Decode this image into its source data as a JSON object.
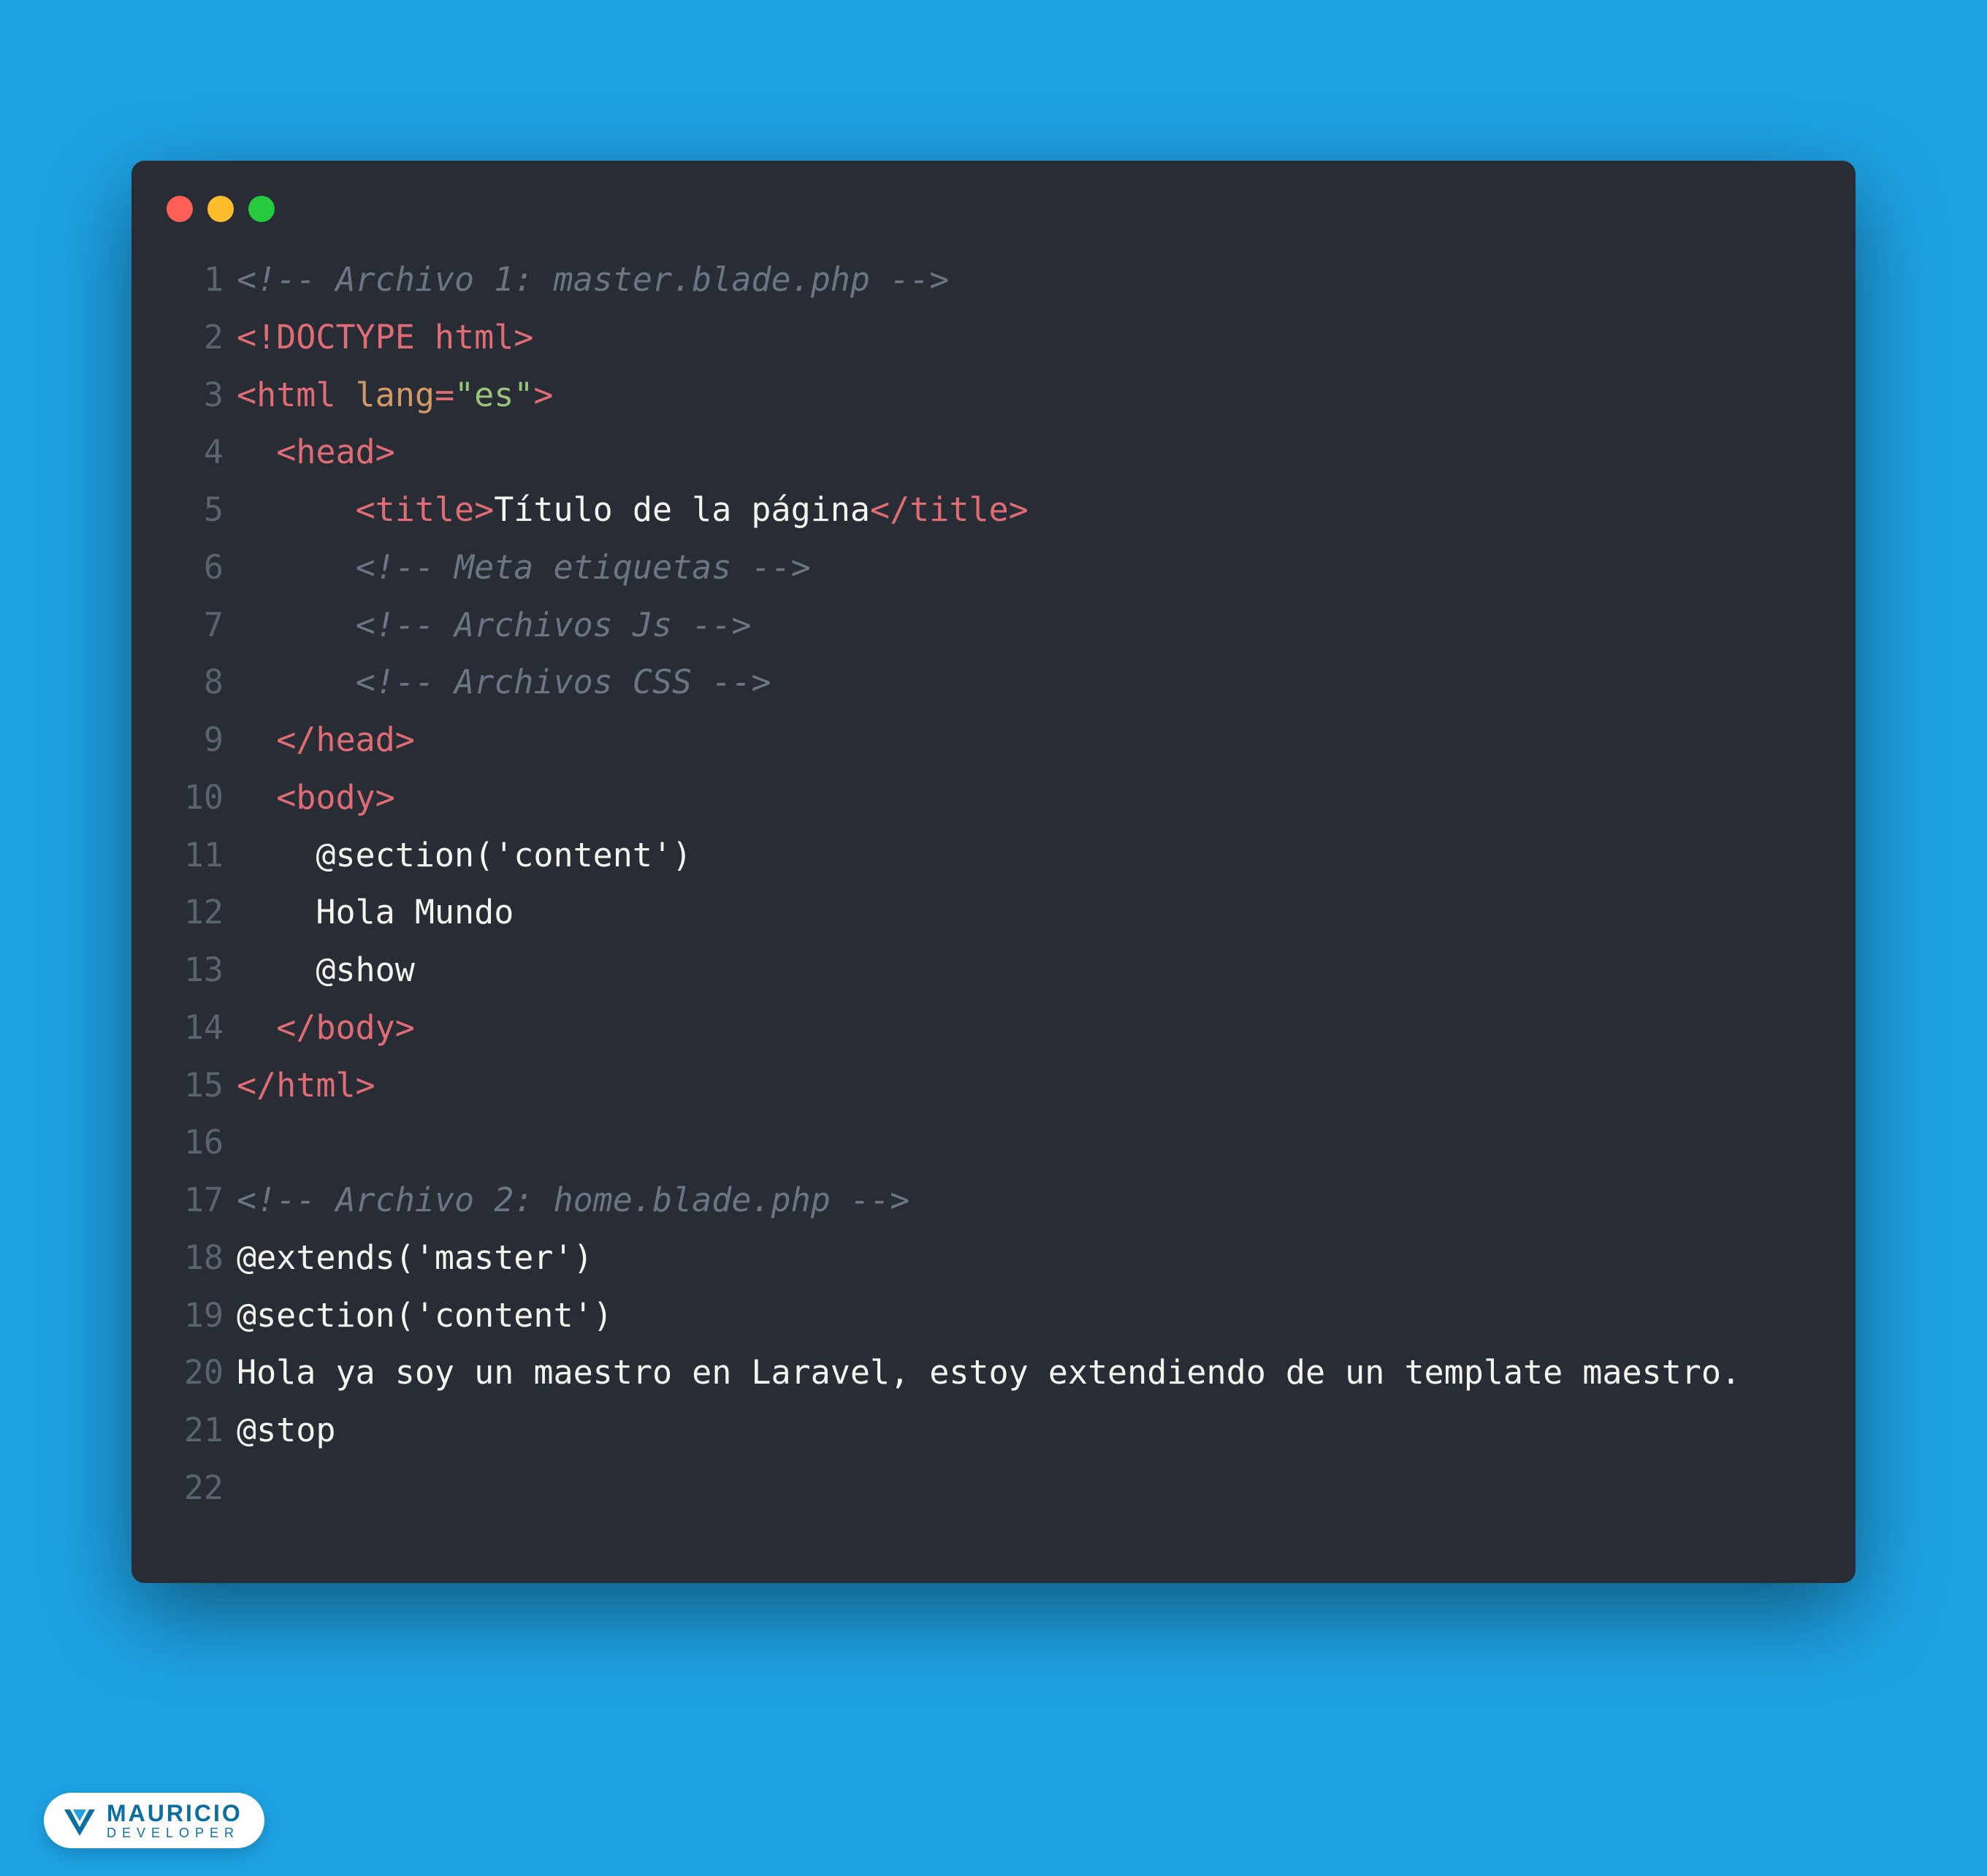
{
  "window": {
    "traffic_lights": [
      "close",
      "minimize",
      "zoom"
    ]
  },
  "code": {
    "lines": [
      {
        "n": 1,
        "segments": [
          {
            "c": "comment",
            "t": "<!--"
          },
          {
            "c": "comment sp",
            "t": " "
          },
          {
            "c": "comment",
            "t": "Archivo"
          },
          {
            "c": "comment sp",
            "t": " "
          },
          {
            "c": "comment",
            "t": "1:"
          },
          {
            "c": "comment sp",
            "t": " "
          },
          {
            "c": "comment",
            "t": "master.blade.php"
          },
          {
            "c": "comment sp",
            "t": " "
          },
          {
            "c": "comment",
            "t": "-->"
          }
        ]
      },
      {
        "n": 2,
        "segments": [
          {
            "c": "tag",
            "t": "<!DOCTYPE html>"
          }
        ]
      },
      {
        "n": 3,
        "segments": [
          {
            "c": "tag",
            "t": "<html "
          },
          {
            "c": "attr",
            "t": "lang"
          },
          {
            "c": "tag",
            "t": "="
          },
          {
            "c": "str",
            "t": "\"es\""
          },
          {
            "c": "tag",
            "t": ">"
          }
        ]
      },
      {
        "n": 4,
        "indent": "  ",
        "segments": [
          {
            "c": "tag",
            "t": "<head>"
          }
        ]
      },
      {
        "n": 5,
        "indent": "      ",
        "segments": [
          {
            "c": "tag",
            "t": "<title>"
          },
          {
            "c": "plain",
            "t": "Título de la página"
          },
          {
            "c": "tag",
            "t": "</title>"
          }
        ]
      },
      {
        "n": 6,
        "indent": "      ",
        "segments": [
          {
            "c": "comment",
            "t": "<!--"
          },
          {
            "c": "comment sp",
            "t": " "
          },
          {
            "c": "comment",
            "t": "Meta"
          },
          {
            "c": "comment sp",
            "t": " "
          },
          {
            "c": "comment",
            "t": "etiquetas"
          },
          {
            "c": "comment sp",
            "t": " "
          },
          {
            "c": "comment",
            "t": "-->"
          }
        ]
      },
      {
        "n": 7,
        "indent": "      ",
        "segments": [
          {
            "c": "comment",
            "t": "<!--"
          },
          {
            "c": "comment sp",
            "t": " "
          },
          {
            "c": "comment",
            "t": "Archivos"
          },
          {
            "c": "comment sp",
            "t": " "
          },
          {
            "c": "comment",
            "t": "Js"
          },
          {
            "c": "comment sp",
            "t": " "
          },
          {
            "c": "comment",
            "t": "-->"
          }
        ]
      },
      {
        "n": 8,
        "indent": "      ",
        "segments": [
          {
            "c": "comment",
            "t": "<!--"
          },
          {
            "c": "comment sp",
            "t": " "
          },
          {
            "c": "comment",
            "t": "Archivos"
          },
          {
            "c": "comment sp",
            "t": " "
          },
          {
            "c": "comment",
            "t": "CSS"
          },
          {
            "c": "comment sp",
            "t": " "
          },
          {
            "c": "comment",
            "t": "-->"
          }
        ]
      },
      {
        "n": 9,
        "indent": "  ",
        "segments": [
          {
            "c": "tag",
            "t": "</head>"
          }
        ]
      },
      {
        "n": 10,
        "indent": "  ",
        "segments": [
          {
            "c": "tag",
            "t": "<body>"
          }
        ]
      },
      {
        "n": 11,
        "indent": "    ",
        "segments": [
          {
            "c": "plain",
            "t": "@section('content')"
          }
        ]
      },
      {
        "n": 12,
        "indent": "    ",
        "segments": [
          {
            "c": "plain",
            "t": "Hola Mundo"
          }
        ]
      },
      {
        "n": 13,
        "indent": "    ",
        "segments": [
          {
            "c": "plain",
            "t": "@show"
          }
        ]
      },
      {
        "n": 14,
        "indent": "  ",
        "segments": [
          {
            "c": "tag",
            "t": "</body>"
          }
        ]
      },
      {
        "n": 15,
        "segments": [
          {
            "c": "tag",
            "t": "</html>"
          }
        ]
      },
      {
        "n": 16,
        "segments": []
      },
      {
        "n": 17,
        "segments": [
          {
            "c": "comment",
            "t": "<!--"
          },
          {
            "c": "comment sp",
            "t": " "
          },
          {
            "c": "comment",
            "t": "Archivo"
          },
          {
            "c": "comment sp",
            "t": " "
          },
          {
            "c": "comment",
            "t": "2:"
          },
          {
            "c": "comment sp",
            "t": " "
          },
          {
            "c": "comment",
            "t": "home.blade.php"
          },
          {
            "c": "comment sp",
            "t": " "
          },
          {
            "c": "comment",
            "t": "-->"
          }
        ]
      },
      {
        "n": 18,
        "segments": [
          {
            "c": "plain",
            "t": "@extends('master')"
          }
        ]
      },
      {
        "n": 19,
        "segments": [
          {
            "c": "plain",
            "t": "@section('content')"
          }
        ]
      },
      {
        "n": 20,
        "segments": [
          {
            "c": "plain",
            "t": "Hola ya soy un maestro en Laravel, estoy extendiendo de un template maestro."
          }
        ]
      },
      {
        "n": 21,
        "segments": [
          {
            "c": "plain",
            "t": "@stop"
          }
        ]
      },
      {
        "n": 22,
        "segments": []
      }
    ]
  },
  "footer": {
    "name": "MAURICIO",
    "subtitle": "DEVELOPER"
  }
}
